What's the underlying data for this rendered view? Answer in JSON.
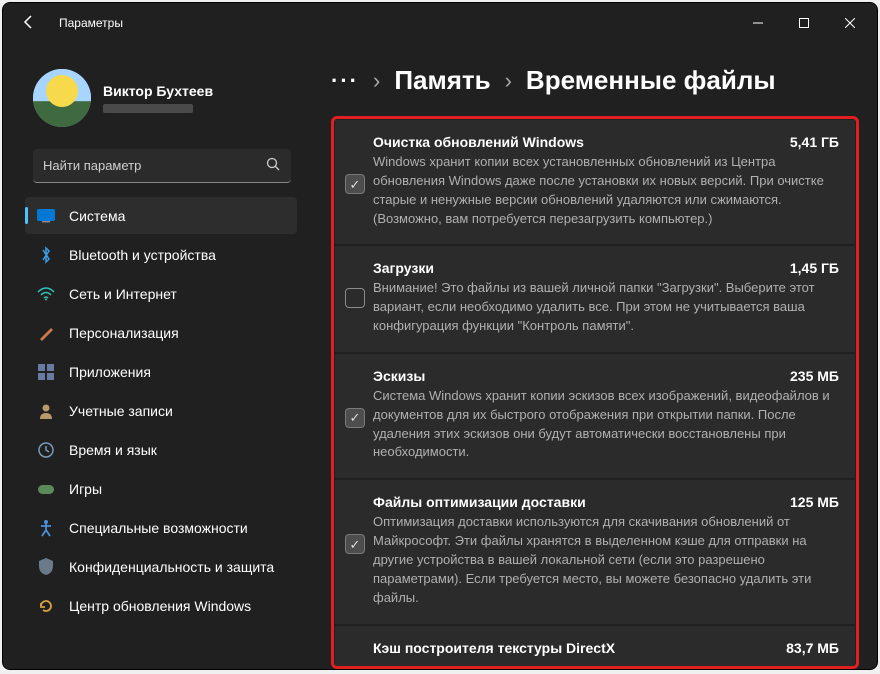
{
  "app_title": "Параметры",
  "user": {
    "name": "Виктор Бухтеев"
  },
  "search": {
    "placeholder": "Найти параметр"
  },
  "nav": [
    {
      "label": "Система",
      "icon": "monitor",
      "active": true
    },
    {
      "label": "Bluetooth и устройства",
      "icon": "bluetooth"
    },
    {
      "label": "Сеть и Интернет",
      "icon": "wifi"
    },
    {
      "label": "Персонализация",
      "icon": "brush"
    },
    {
      "label": "Приложения",
      "icon": "apps"
    },
    {
      "label": "Учетные записи",
      "icon": "person"
    },
    {
      "label": "Время и язык",
      "icon": "clock"
    },
    {
      "label": "Игры",
      "icon": "game"
    },
    {
      "label": "Специальные возможности",
      "icon": "accessibility"
    },
    {
      "label": "Конфиденциальность и защита",
      "icon": "shield"
    },
    {
      "label": "Центр обновления Windows",
      "icon": "update"
    }
  ],
  "breadcrumb": {
    "dots": "···",
    "part1": "Память",
    "part2": "Временные файлы"
  },
  "items": [
    {
      "title": "Очистка обновлений Windows",
      "size": "5,41 ГБ",
      "checked": true,
      "desc": "Windows хранит копии всех установленных обновлений из Центра обновления Windows даже после установки их новых версий. При очистке старые и ненужные версии обновлений удаляются или сжимаются. (Возможно, вам потребуется перезагрузить компьютер.)"
    },
    {
      "title": "Загрузки",
      "size": "1,45 ГБ",
      "checked": false,
      "desc": "Внимание! Это файлы из вашей личной папки \"Загрузки\". Выберите этот вариант, если необходимо удалить все. При этом не учитывается ваша конфигурация функции \"Контроль памяти\"."
    },
    {
      "title": "Эскизы",
      "size": "235 МБ",
      "checked": true,
      "desc": "Система Windows хранит копии эскизов всех изображений, видеофайлов и документов для их быстрого отображения при открытии папки. После удаления этих эскизов они будут автоматически восстановлены при необходимости."
    },
    {
      "title": "Файлы оптимизации доставки",
      "size": "125 МБ",
      "checked": true,
      "desc": "Оптимизация доставки используются для скачивания обновлений от Майкрософт. Эти файлы хранятся в выделенном кэше для отправки на другие устройства в вашей локальной сети (если это разрешено параметрами). Если требуется место, вы можете безопасно удалить эти файлы."
    },
    {
      "title": "Кэш построителя текстуры DirectX",
      "size": "83,7 МБ",
      "checked": true,
      "desc": ""
    }
  ]
}
